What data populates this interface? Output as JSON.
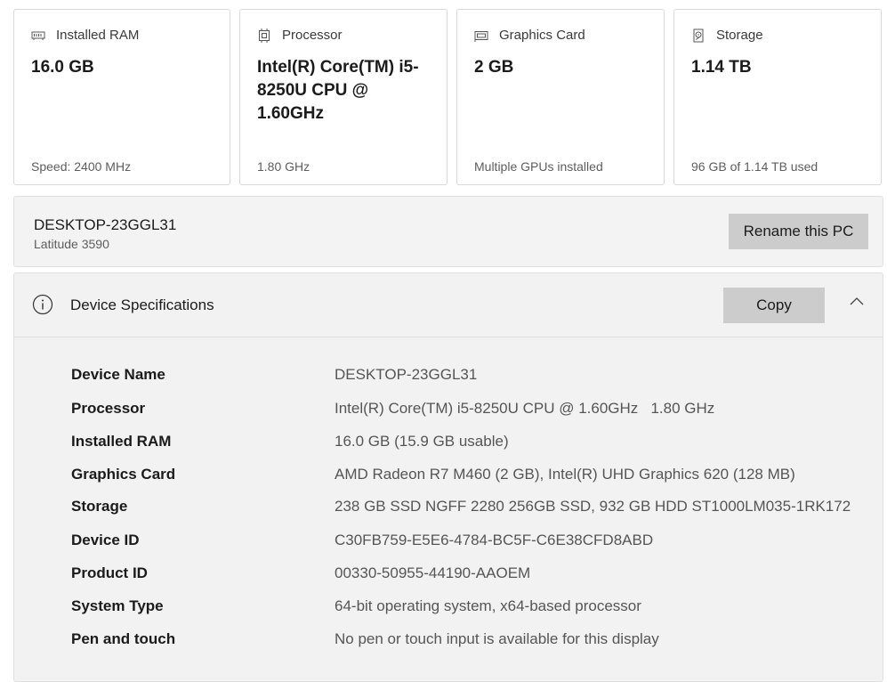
{
  "cards": [
    {
      "title": "Installed RAM",
      "value": "16.0 GB",
      "sub": "Speed: 2400 MHz",
      "icon": "ram-icon"
    },
    {
      "title": "Processor",
      "value": "Intel(R) Core(TM) i5-8250U CPU @ 1.60GHz",
      "sub": "1.80 GHz",
      "icon": "processor-icon"
    },
    {
      "title": "Graphics Card",
      "value": "2 GB",
      "sub": "Multiple GPUs installed",
      "icon": "graphics-card-icon"
    },
    {
      "title": "Storage",
      "value": "1.14 TB",
      "sub": "96 GB of 1.14 TB used",
      "icon": "storage-icon"
    }
  ],
  "pc": {
    "name": "DESKTOP-23GGL31",
    "model": "Latitude 3590",
    "rename_label": "Rename this PC"
  },
  "specs": {
    "title": "Device Specifications",
    "copy_label": "Copy",
    "rows": [
      {
        "label": "Device Name",
        "value": "DESKTOP-23GGL31"
      },
      {
        "label": "Processor",
        "value": "Intel(R) Core(TM) i5-8250U CPU @ 1.60GHz   1.80 GHz"
      },
      {
        "label": "Installed RAM",
        "value": "16.0 GB (15.9 GB usable)"
      },
      {
        "label": "Graphics Card",
        "value": "AMD Radeon R7 M460 (2 GB), Intel(R) UHD Graphics 620 (128 MB)"
      },
      {
        "label": "Storage",
        "value": "238 GB SSD NGFF 2280 256GB SSD, 932 GB HDD ST1000LM035-1RK172"
      },
      {
        "label": "Device ID",
        "value": "C30FB759-E5E6-4784-BC5F-C6E38CFD8ABD"
      },
      {
        "label": "Product ID",
        "value": "00330-50955-44190-AAOEM"
      },
      {
        "label": "System Type",
        "value": "64-bit operating system, x64-based processor"
      },
      {
        "label": "Pen and touch",
        "value": "No pen or touch input is available for this display"
      }
    ]
  }
}
